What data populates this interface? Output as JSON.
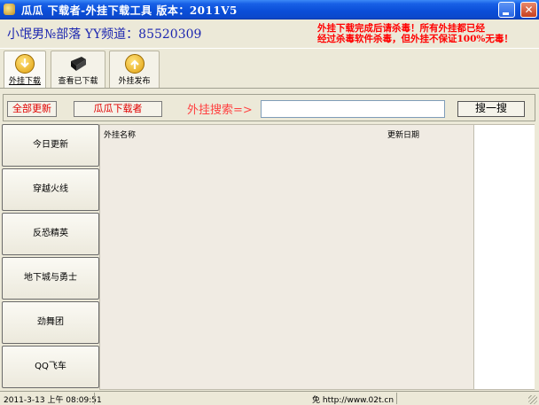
{
  "window": {
    "title": "瓜瓜 下载者-外挂下载工具 版本：2011V5",
    "minimize_glyph": "",
    "close_glyph": "✕"
  },
  "header": {
    "channel": "小氓男№部落 YY频道：85520309",
    "warning_line1": "外挂下载完成后请杀毒！所有外挂都已经",
    "warning_line2": "经过杀毒软件杀毒，但外挂不保证100%无毒！"
  },
  "toolbar": {
    "items": [
      {
        "label": "外挂下载",
        "icon": "download-arrow-icon"
      },
      {
        "label": "查看已下载",
        "icon": "folder-icon"
      },
      {
        "label": "外挂发布",
        "icon": "upload-arrow-icon"
      }
    ]
  },
  "search": {
    "all_update_label": "全部更新",
    "guagua_label": "瓜瓜下载者",
    "search_label": "外挂搜索=>",
    "input_value": "",
    "search_button_label": "搜一搜"
  },
  "sidebar": {
    "items": [
      {
        "label": "今日更新"
      },
      {
        "label": "穿越火线"
      },
      {
        "label": "反恐精英"
      },
      {
        "label": "地下城与勇士"
      },
      {
        "label": "劲舞团"
      },
      {
        "label": "QQ飞车"
      }
    ]
  },
  "list": {
    "columns": [
      "外挂名称",
      "更新日期"
    ],
    "rows": []
  },
  "status": {
    "datetime": "2011-3-13 上午 08:09:51",
    "url": "免 http://www.02t.cn"
  },
  "colors": {
    "titlebar": "#0a4ed8",
    "channel_text": "#1d27b0",
    "warning_text": "#ff0000",
    "button_red_text": "#e00000",
    "window_bg": "#ece9d8"
  }
}
